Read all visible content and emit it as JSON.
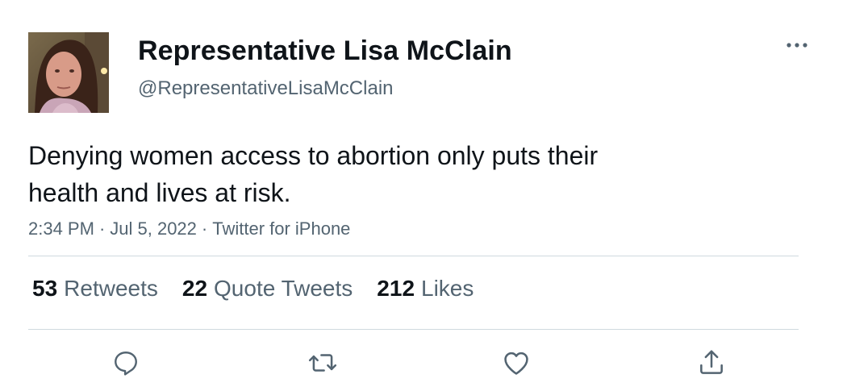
{
  "author": {
    "display_name": "Representative Lisa McClain",
    "handle": "@RepresentativeLisaMcClain"
  },
  "tweet": {
    "text_line1": "Denying women access to abortion only puts their",
    "text_line2": "health and lives at risk.",
    "time": "2:34 PM",
    "date": "Jul 5, 2022",
    "source": "Twitter for iPhone",
    "separator": "·"
  },
  "stats": {
    "retweets_count": "53",
    "retweets_label": "Retweets",
    "quotes_count": "22",
    "quotes_label": "Quote Tweets",
    "likes_count": "212",
    "likes_label": "Likes"
  },
  "actions": {
    "reply_icon": "reply-icon",
    "retweet_icon": "retweet-icon",
    "like_icon": "heart-icon",
    "share_icon": "share-icon",
    "more_icon": "more-icon"
  },
  "colors": {
    "text_primary": "#0f1419",
    "text_secondary": "#536471",
    "divider": "#cfd9de"
  }
}
